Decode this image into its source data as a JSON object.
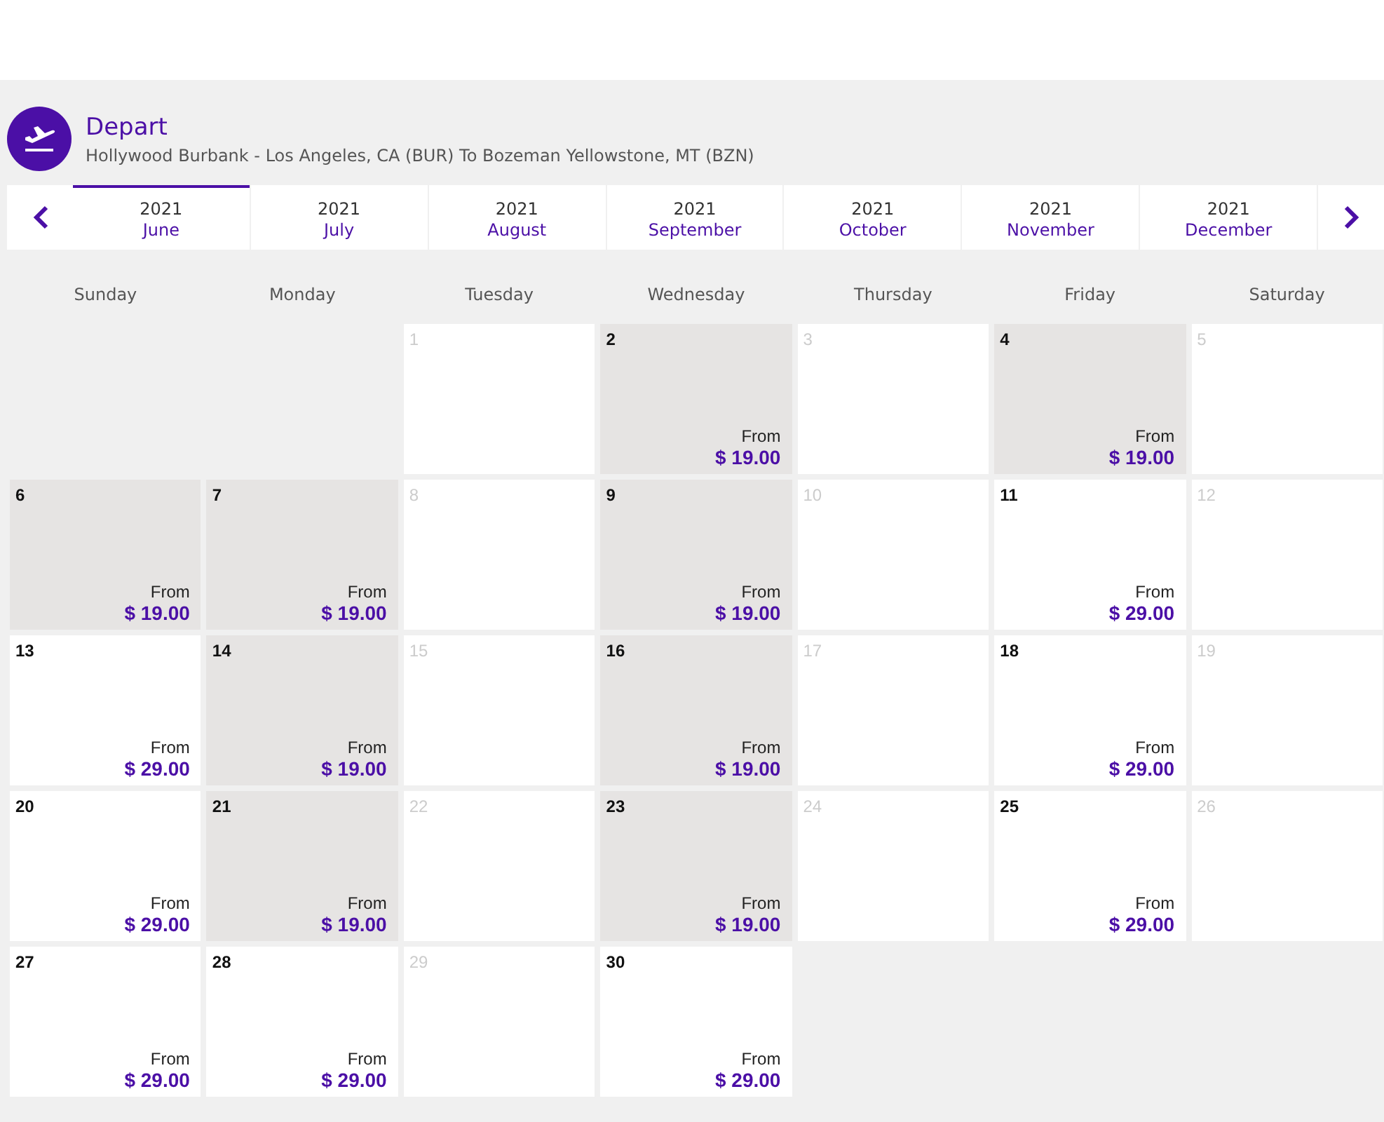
{
  "header": {
    "title": "Depart",
    "route": "Hollywood Burbank - Los Angeles, CA (BUR) To Bozeman Yellowstone, MT (BZN)"
  },
  "months": [
    {
      "year": "2021",
      "month": "June",
      "selected": true
    },
    {
      "year": "2021",
      "month": "July",
      "selected": false
    },
    {
      "year": "2021",
      "month": "August",
      "selected": false
    },
    {
      "year": "2021",
      "month": "September",
      "selected": false
    },
    {
      "year": "2021",
      "month": "October",
      "selected": false
    },
    {
      "year": "2021",
      "month": "November",
      "selected": false
    },
    {
      "year": "2021",
      "month": "December",
      "selected": false
    }
  ],
  "weekdays": [
    "Sunday",
    "Monday",
    "Tuesday",
    "Wednesday",
    "Thursday",
    "Friday",
    "Saturday"
  ],
  "weeks": [
    [
      {
        "kind": "blank"
      },
      {
        "kind": "blank"
      },
      {
        "kind": "day",
        "day": "1",
        "available": false
      },
      {
        "kind": "day",
        "day": "2",
        "available": true,
        "cheapest": true,
        "from": "From",
        "price": "$ 19.00"
      },
      {
        "kind": "day",
        "day": "3",
        "available": false
      },
      {
        "kind": "day",
        "day": "4",
        "available": true,
        "cheapest": true,
        "from": "From",
        "price": "$ 19.00"
      },
      {
        "kind": "day",
        "day": "5",
        "available": false
      }
    ],
    [
      {
        "kind": "day",
        "day": "6",
        "available": true,
        "cheapest": true,
        "from": "From",
        "price": "$ 19.00"
      },
      {
        "kind": "day",
        "day": "7",
        "available": true,
        "cheapest": true,
        "from": "From",
        "price": "$ 19.00"
      },
      {
        "kind": "day",
        "day": "8",
        "available": false
      },
      {
        "kind": "day",
        "day": "9",
        "available": true,
        "cheapest": true,
        "from": "From",
        "price": "$ 19.00"
      },
      {
        "kind": "day",
        "day": "10",
        "available": false
      },
      {
        "kind": "day",
        "day": "11",
        "available": true,
        "cheapest": false,
        "from": "From",
        "price": "$ 29.00"
      },
      {
        "kind": "day",
        "day": "12",
        "available": false
      }
    ],
    [
      {
        "kind": "day",
        "day": "13",
        "available": true,
        "cheapest": false,
        "from": "From",
        "price": "$ 29.00"
      },
      {
        "kind": "day",
        "day": "14",
        "available": true,
        "cheapest": true,
        "from": "From",
        "price": "$ 19.00"
      },
      {
        "kind": "day",
        "day": "15",
        "available": false
      },
      {
        "kind": "day",
        "day": "16",
        "available": true,
        "cheapest": true,
        "from": "From",
        "price": "$ 19.00"
      },
      {
        "kind": "day",
        "day": "17",
        "available": false
      },
      {
        "kind": "day",
        "day": "18",
        "available": true,
        "cheapest": false,
        "from": "From",
        "price": "$ 29.00"
      },
      {
        "kind": "day",
        "day": "19",
        "available": false
      }
    ],
    [
      {
        "kind": "day",
        "day": "20",
        "available": true,
        "cheapest": false,
        "from": "From",
        "price": "$ 29.00"
      },
      {
        "kind": "day",
        "day": "21",
        "available": true,
        "cheapest": true,
        "from": "From",
        "price": "$ 19.00"
      },
      {
        "kind": "day",
        "day": "22",
        "available": false
      },
      {
        "kind": "day",
        "day": "23",
        "available": true,
        "cheapest": true,
        "from": "From",
        "price": "$ 19.00"
      },
      {
        "kind": "day",
        "day": "24",
        "available": false
      },
      {
        "kind": "day",
        "day": "25",
        "available": true,
        "cheapest": false,
        "from": "From",
        "price": "$ 29.00"
      },
      {
        "kind": "day",
        "day": "26",
        "available": false
      }
    ],
    [
      {
        "kind": "day",
        "day": "27",
        "available": true,
        "cheapest": false,
        "from": "From",
        "price": "$ 29.00"
      },
      {
        "kind": "day",
        "day": "28",
        "available": true,
        "cheapest": false,
        "from": "From",
        "price": "$ 29.00"
      },
      {
        "kind": "day",
        "day": "29",
        "available": false
      },
      {
        "kind": "day",
        "day": "30",
        "available": true,
        "cheapest": false,
        "from": "From",
        "price": "$ 29.00"
      }
    ]
  ]
}
